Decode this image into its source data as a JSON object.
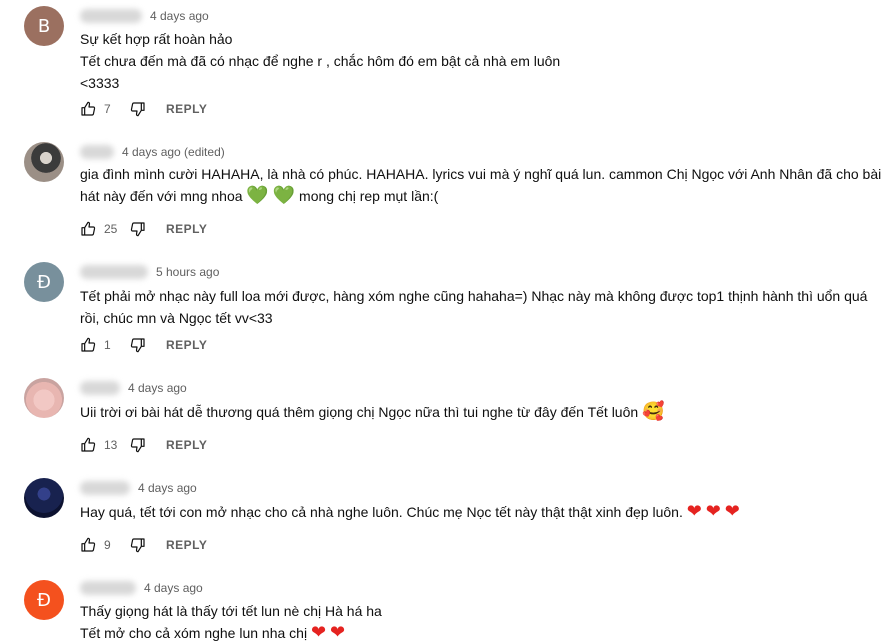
{
  "comments": [
    {
      "avatar_letter": "B",
      "avatar_color": "#9b7060",
      "date": "4 days ago",
      "lines": [
        "Sự kết hợp rất hoàn hảo",
        "Tết chưa đến mà đã có nhạc để nghe r , chắc hôm đó em bật cả nhà em luôn",
        "<3333"
      ],
      "likes": "7",
      "reply_label": "REPLY"
    },
    {
      "avatar_letter": "",
      "date": "4 days ago (edited)",
      "line1": "gia đình mình cười HAHAHA, là nhà có phúc. HAHAHA. lyrics vui mà ý nghĩ quá lun. cammon Chị Ngọc với Anh Nhân đã cho bài",
      "line2_text": "hát này đến với mng nhoa",
      "line2_after": "mong chị rep mụt lần:(",
      "emoji_green_heart": "💚",
      "likes": "25",
      "reply_label": "REPLY"
    },
    {
      "avatar_letter": "Đ",
      "avatar_color": "#78909c",
      "date": "5 hours ago",
      "lines": [
        "Tết phải mở nhạc này full loa mới được, hàng xóm nghe cũng hahaha=) Nhạc này mà không được top1 thịnh hành thì uổn quá",
        "rồi, chúc mn và Ngọc tết vv<33"
      ],
      "likes": "1",
      "reply_label": "REPLY"
    },
    {
      "avatar_letter": "",
      "date": "4 days ago",
      "text": "Uii trời ơi bài hát dễ thương quá thêm giọng chị Ngọc nữa thì tui nghe từ đây đến Tết luôn",
      "emoji": "🥰",
      "likes": "13",
      "reply_label": "REPLY"
    },
    {
      "avatar_letter": "",
      "date": "4 days ago",
      "text": "Hay quá, tết tới con mở nhạc cho cả nhà nghe luôn. Chúc mẹ Nọc tết này thật thật xinh đẹp luôn.",
      "emoji_heart": "❤",
      "likes": "9",
      "reply_label": "REPLY"
    },
    {
      "avatar_letter": "Đ",
      "avatar_color": "#f4511e",
      "date": "4 days ago",
      "line1": "Thấy giọng hát là thấy tới tết lun nè chị Hà há ha",
      "line2": "Tết mở cho cả xóm nghe lun nha chị",
      "emoji_heart": "❤"
    }
  ]
}
